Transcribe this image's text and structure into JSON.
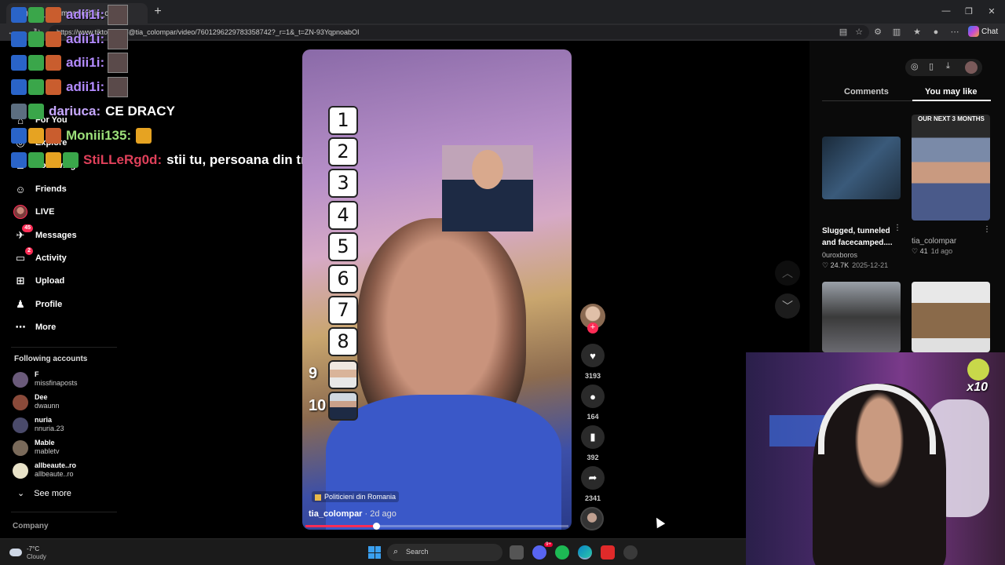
{
  "browser": {
    "tab_title": "(47) Tia_Colompar (@tia_c...",
    "url": "https://www.tiktok.com/@tia_colompar/video/7601296229783358742?_r=1&_t=ZN-93YqpnoabOI",
    "copilot_label": "Chat"
  },
  "sidebar": {
    "items": [
      {
        "label": "For You",
        "icon": "home-icon"
      },
      {
        "label": "Explore",
        "icon": "compass-icon"
      },
      {
        "label": "Following",
        "icon": "following-icon"
      },
      {
        "label": "Friends",
        "icon": "friends-icon"
      },
      {
        "label": "LIVE",
        "icon": "live-icon"
      },
      {
        "label": "Messages",
        "icon": "messages-icon",
        "badge": "45"
      },
      {
        "label": "Activity",
        "icon": "activity-icon",
        "badge": "2"
      },
      {
        "label": "Upload",
        "icon": "upload-icon"
      },
      {
        "label": "Profile",
        "icon": "profile-icon"
      },
      {
        "label": "More",
        "icon": "more-icon"
      }
    ],
    "following_title": "Following accounts",
    "accounts": [
      {
        "name": "F",
        "handle": "missfinaposts"
      },
      {
        "name": "Dee",
        "handle": "dwaunn"
      },
      {
        "name": "nuria",
        "handle": "nnuria.23"
      },
      {
        "name": "Mable",
        "handle": "mabletv"
      },
      {
        "name": "allbeaute..ro",
        "handle": "allbeaute..ro"
      }
    ],
    "see_more": "See more",
    "company": "Company"
  },
  "chat": [
    {
      "user": "adii1i:",
      "color": "#b38bff",
      "message": ""
    },
    {
      "user": "adii1i:",
      "color": "#b38bff",
      "message": ""
    },
    {
      "user": "adii1i:",
      "color": "#b38bff",
      "message": ""
    },
    {
      "user": "adii1i:",
      "color": "#b38bff",
      "message": ""
    },
    {
      "user": "dariuca:",
      "color": "#c7a8ff",
      "message": "CE DRACY"
    },
    {
      "user": "Moniii135:",
      "color": "#9de07a",
      "message": ""
    },
    {
      "user": "StiLLeRg0d:",
      "color": "#e0405a",
      "message": "stii tu, persoana din trecut"
    }
  ],
  "video": {
    "ranks": [
      "1",
      "2",
      "3",
      "4",
      "5",
      "6",
      "7",
      "8",
      "9",
      "10"
    ],
    "tag": "Politicieni din Romania",
    "author": "tia_colompar",
    "posted": "· 2d ago",
    "progress_fraction": 0.27
  },
  "actions": {
    "likes": "3193",
    "comments": "164",
    "saves": "392",
    "shares": "2341"
  },
  "right_panel": {
    "tabs": [
      "Comments",
      "You may like"
    ],
    "selected_tab": "You may like",
    "cards": [
      {
        "title": "Slugged, tunneled and facecamped....",
        "author": "0uroxboros",
        "likes": "24.7K",
        "date": "2025-12-21"
      },
      {
        "title": "",
        "author": "tia_colompar",
        "likes": "41",
        "date": "1d ago",
        "overlay": "OUR NEXT 3 MONTHS"
      }
    ]
  },
  "webcam": {
    "combo": "x10"
  },
  "taskbar": {
    "temp": "-7°C",
    "weather": "Cloudy",
    "search_placeholder": "Search",
    "discord_badge": "9+"
  },
  "colors": {
    "accent": "#fe2c55",
    "background": "#000000"
  }
}
